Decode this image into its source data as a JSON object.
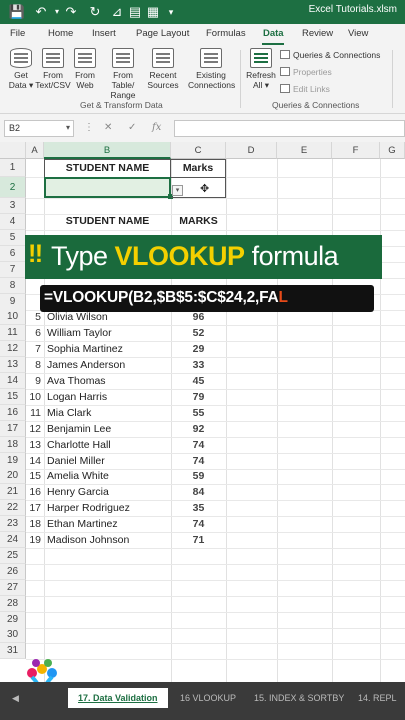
{
  "window": {
    "file_title": "Excel Tutorials.xlsm",
    "quick_access": [
      "save-icon",
      "undo-icon",
      "redo-icon",
      "refresh-icon",
      "filter-icon",
      "table-icon",
      "grid-icon"
    ]
  },
  "ribbon": {
    "tabs": [
      "File",
      "Home",
      "Insert",
      "Page Layout",
      "Formulas",
      "Data",
      "Review",
      "View"
    ],
    "active_tab": "Data",
    "get_transform": {
      "buttons": [
        {
          "line1": "Get",
          "line2": "Data ▾"
        },
        {
          "line1": "From",
          "line2": "Text/CSV"
        },
        {
          "line1": "From",
          "line2": "Web"
        },
        {
          "line1": "From Table/",
          "line2": "Range"
        },
        {
          "line1": "Recent",
          "line2": "Sources"
        },
        {
          "line1": "Existing",
          "line2": "Connections"
        }
      ],
      "label": "Get & Transform Data"
    },
    "queries": {
      "refresh_line1": "Refresh",
      "refresh_line2": "All ▾",
      "items": [
        "Queries & Connections",
        "Properties",
        "Edit Links"
      ],
      "label": "Queries & Connections"
    }
  },
  "formula_bar": {
    "name_box": "B2",
    "cancel": "✕",
    "enter": "✓",
    "fx": "fx",
    "value": ""
  },
  "grid": {
    "columns": [
      "A",
      "B",
      "C",
      "D",
      "E",
      "F",
      "G"
    ],
    "rows": [
      "1",
      "2",
      "3",
      "4",
      "5",
      "6",
      "7",
      "8",
      "9",
      "10",
      "11",
      "12",
      "13",
      "14",
      "15",
      "16",
      "17",
      "18",
      "19",
      "20",
      "21",
      "22",
      "23",
      "24",
      "25",
      "26",
      "27",
      "28",
      "29",
      "30",
      "31"
    ],
    "lookup_header": {
      "name": "STUDENT NAME",
      "marks": "Marks"
    },
    "table_header": {
      "name": "STUDENT NAME",
      "marks": "MARKS"
    },
    "students": [
      {
        "idx": "5",
        "name": "Olivia Wilson",
        "marks": "96"
      },
      {
        "idx": "6",
        "name": "William Taylor",
        "marks": "52"
      },
      {
        "idx": "7",
        "name": "Sophia Martinez",
        "marks": "29"
      },
      {
        "idx": "8",
        "name": "James Anderson",
        "marks": "33"
      },
      {
        "idx": "9",
        "name": "Ava Thomas",
        "marks": "45"
      },
      {
        "idx": "10",
        "name": "Logan Harris",
        "marks": "79"
      },
      {
        "idx": "11",
        "name": "Mia Clark",
        "marks": "55"
      },
      {
        "idx": "12",
        "name": "Benjamin Lee",
        "marks": "92"
      },
      {
        "idx": "13",
        "name": "Charlotte Hall",
        "marks": "74"
      },
      {
        "idx": "14",
        "name": "Daniel Miller",
        "marks": "74"
      },
      {
        "idx": "15",
        "name": "Amelia White",
        "marks": "59"
      },
      {
        "idx": "16",
        "name": "Henry Garcia",
        "marks": "84"
      },
      {
        "idx": "17",
        "name": "Harper Rodriguez",
        "marks": "35"
      },
      {
        "idx": "18",
        "name": "Ethan Martinez",
        "marks": "74"
      },
      {
        "idx": "19",
        "name": "Madison Johnson",
        "marks": "71"
      }
    ]
  },
  "overlay": {
    "banner_prefix": "‼",
    "banner_word1": "Type ",
    "banner_highlight": "VLOOKUP",
    "banner_word2": " formula",
    "formula_main": "=VLOOKUP(B2,$B$5:$C$24,2,FA",
    "formula_tail": "L"
  },
  "sheet_tabs": {
    "tabs": [
      "17. Data Validation",
      "16 VLOOKUP",
      "15. INDEX & SORTBY",
      "14. REPL"
    ],
    "active": "17. Data Validation"
  },
  "colors": {
    "excel_green": "#1d6f42",
    "banner_bg": "#1a6a3c",
    "highlight_yellow": "#f4d000",
    "selected_cell": "#e2f0e3"
  }
}
